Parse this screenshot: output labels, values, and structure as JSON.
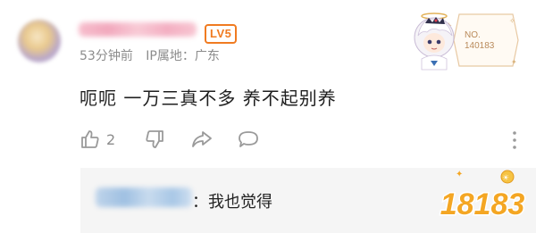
{
  "comment": {
    "level_badge": "LV5",
    "time_ago": "53分钟前",
    "ip_location": "IP属地：广东",
    "text": "呃呃  一万三真不多 养不起别养",
    "like_count": "2"
  },
  "fan_badge": {
    "number_label": "NO.",
    "number": "140183"
  },
  "reply": {
    "text": "：我也觉得"
  },
  "watermark": {
    "logo_text": "18183"
  },
  "colors": {
    "level_badge": "#f07b21",
    "meta_text": "#8c8c8c",
    "icon_gray": "#9a9a9a",
    "reply_bg": "#f5f5f5",
    "watermark_fill": "#f4a623"
  }
}
